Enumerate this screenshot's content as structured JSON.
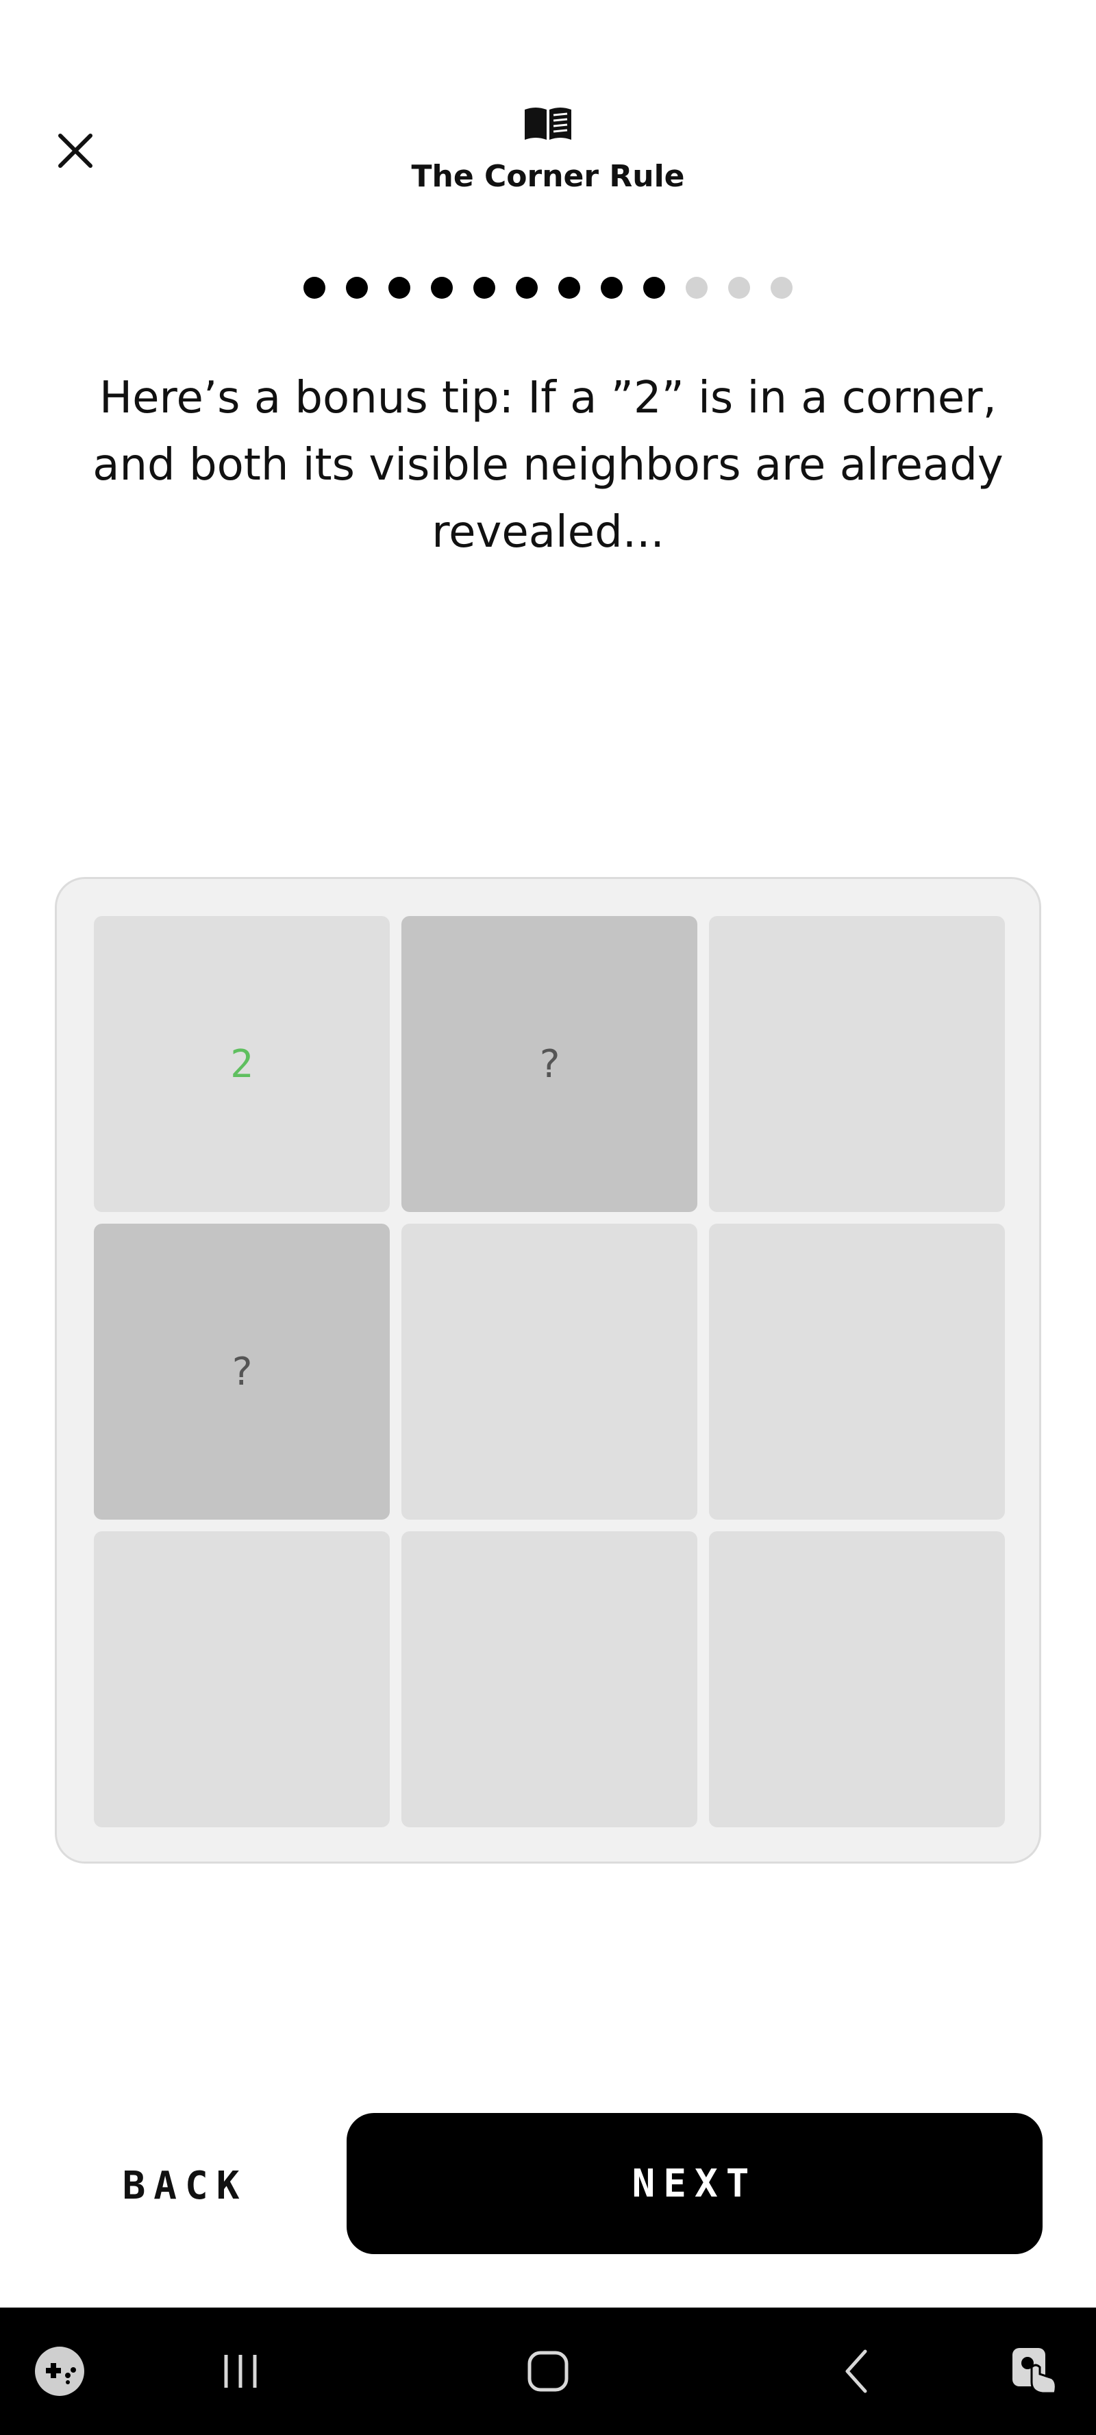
{
  "header": {
    "title": "The Corner Rule",
    "close_icon": "close-icon",
    "book_icon": "book-open-icon"
  },
  "progress": {
    "total_steps": 12,
    "current_step": 9
  },
  "tip": {
    "text": "Here’s a bonus tip: If a ”2” is in a corner, and both its visible neighbors are already revealed..."
  },
  "board": {
    "cells": [
      {
        "label": "2",
        "state": "revealed-number"
      },
      {
        "label": "?",
        "state": "hidden"
      },
      {
        "label": "",
        "state": "revealed"
      },
      {
        "label": "?",
        "state": "hidden"
      },
      {
        "label": "",
        "state": "revealed"
      },
      {
        "label": "",
        "state": "revealed"
      },
      {
        "label": "",
        "state": "revealed"
      },
      {
        "label": "",
        "state": "revealed"
      },
      {
        "label": "",
        "state": "revealed"
      }
    ],
    "number_color": "#5fbf5f",
    "hidden_color": "#c4c4c4",
    "revealed_color": "#dfdfdf"
  },
  "actions": {
    "back_label": "BACK",
    "next_label": "NEXT"
  },
  "system_nav": {
    "items": [
      "game-launcher-icon",
      "recent-apps-icon",
      "home-icon",
      "back-arrow-icon",
      "assistant-touch-icon"
    ]
  }
}
